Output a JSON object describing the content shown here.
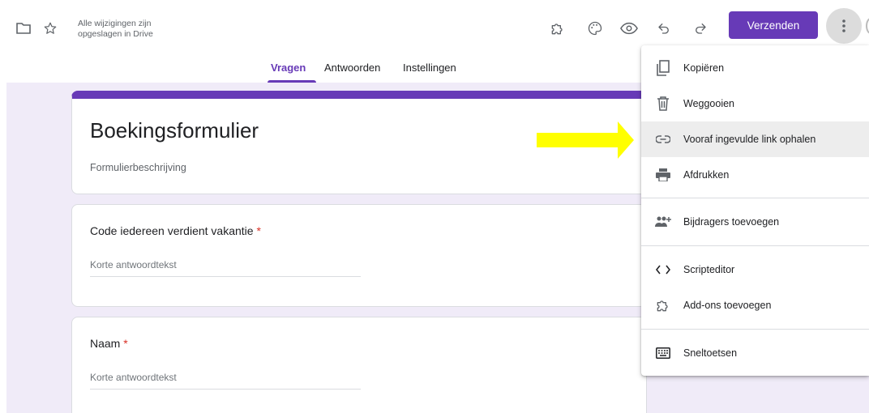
{
  "topbar": {
    "save_status": "Alle wijzigingen zijn opgeslagen in Drive",
    "send_label": "Verzenden",
    "icons": [
      "folder-icon",
      "star-icon",
      "addon-icon",
      "palette-icon",
      "preview-icon",
      "undo-icon",
      "redo-icon",
      "more-vert-icon"
    ]
  },
  "tabs": [
    {
      "label": "Vragen",
      "active": true
    },
    {
      "label": "Antwoorden",
      "active": false
    },
    {
      "label": "Instellingen",
      "active": false
    }
  ],
  "form": {
    "title": "Boekingsformulier",
    "description": "Formulierbeschrijving",
    "questions": [
      {
        "label": "Code iedereen verdient vakantie",
        "required_mark": "*",
        "placeholder": "Korte antwoordtekst"
      },
      {
        "label": "Naam",
        "required_mark": "*",
        "placeholder": "Korte antwoordtekst"
      }
    ]
  },
  "menu": {
    "items": [
      {
        "label": "Kopiëren",
        "icon": "copy-icon"
      },
      {
        "label": "Weggooien",
        "icon": "trash-icon"
      },
      {
        "label": "Vooraf ingevulde link ophalen",
        "icon": "link-icon",
        "highlighted": true
      },
      {
        "label": "Afdrukken",
        "icon": "print-icon"
      },
      {
        "label": "Bijdragers toevoegen",
        "icon": "add-people-icon"
      },
      {
        "label": "Scripteditor",
        "icon": "code-icon"
      },
      {
        "label": "Add-ons toevoegen",
        "icon": "addon-icon"
      },
      {
        "label": "Sneltoetsen",
        "icon": "keyboard-icon"
      }
    ]
  },
  "colors": {
    "accent": "#673ab7",
    "background": "#f0ebf8",
    "required": "#d93025",
    "arrow": "#ffff00"
  }
}
